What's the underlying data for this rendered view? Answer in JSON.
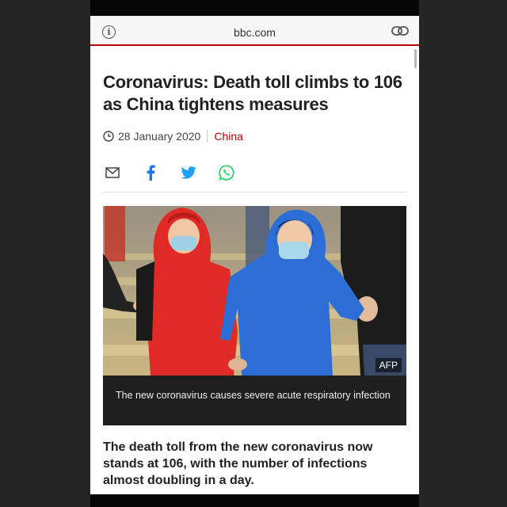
{
  "browser": {
    "url_host": "bbc.com",
    "info_icon": "info-icon",
    "link_icon": "link-icon"
  },
  "article": {
    "headline": "Coronavirus: Death toll climbs to 106 as China tightens measures",
    "date": "28 January 2020",
    "category": "China",
    "share_icons": [
      "email-icon",
      "facebook-icon",
      "twitter-icon",
      "whatsapp-icon"
    ],
    "image_credit": "AFP",
    "image_caption": "The new coronavirus causes severe acute respiratory infection",
    "lead": "The death toll from the new coronavirus now stands at 106, with the number of infections almost doubling in a day."
  },
  "colors": {
    "accent": "#b80000",
    "facebook": "#1877f2",
    "twitter": "#1da1f2",
    "whatsapp": "#25d366"
  }
}
